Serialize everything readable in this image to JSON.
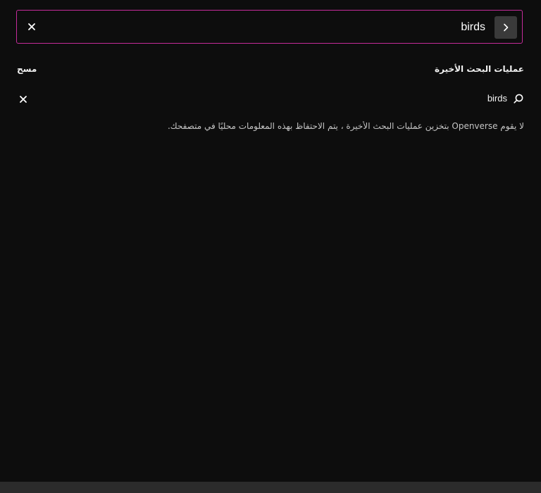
{
  "search": {
    "value": "birds",
    "clear_icon": "close-icon",
    "submit_icon": "chevron-right-icon"
  },
  "recent": {
    "title": "عمليات البحث الأخيرة",
    "clear_label": "مسح",
    "items": [
      {
        "label": "birds",
        "icon": "search-icon",
        "remove_icon": "close-icon"
      }
    ],
    "notice": "لا يقوم Openverse بتخزين عمليات البحث الأخيرة ، يتم الاحتفاظ بهذه المعلومات محليًا في متصفحك."
  },
  "colors": {
    "background": "#0d0d0d",
    "accent_border": "#c52b9b",
    "submit_button": "#3a3a3a",
    "bottom_bar": "#2b2b2b"
  }
}
